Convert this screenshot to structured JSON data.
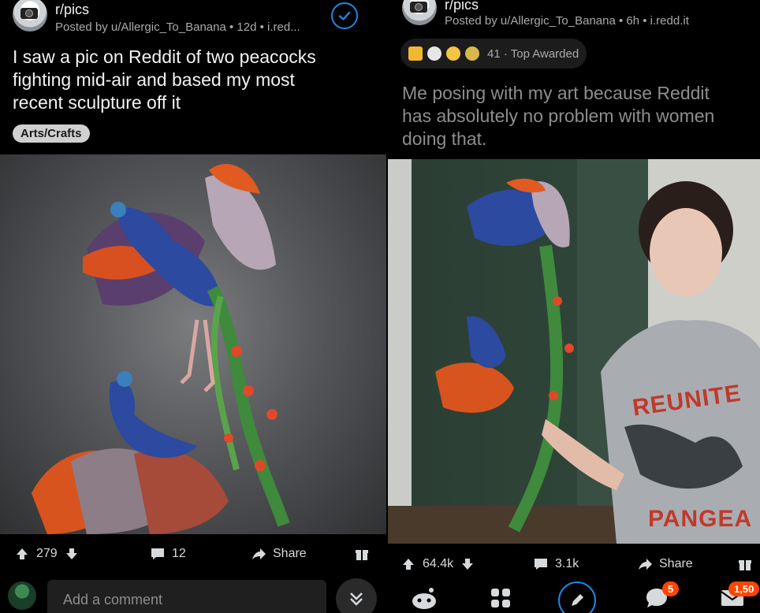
{
  "left": {
    "subreddit": "r/pics",
    "meta": "Posted by u/Allergic_To_Banana • 12d • i.red...",
    "title_lines": [
      "I saw a pic on Reddit of two peacocks",
      "fighting mid-air and based my most",
      "recent sculpture off it"
    ],
    "flair": "Arts/Crafts",
    "upvotes": "279",
    "comments": "12",
    "share": "Share",
    "comment_placeholder": "Add a comment"
  },
  "right": {
    "subreddit": "r/pics",
    "meta": "Posted by u/Allergic_To_Banana • 6h • i.redd.it",
    "awards_text": "41 · Top Awarded",
    "title_lines": [
      "Me posing with my art because Reddit",
      "has absolutely no problem with women",
      "doing that."
    ],
    "upvotes": "64.4k",
    "comments": "3.1k",
    "share": "Share",
    "chat_badge": "5",
    "inbox_badge": "1,50"
  },
  "colors": {
    "accent_blue": "#1e88e5",
    "brand_orange": "#ff4500",
    "awards_gold": "#f2b633"
  },
  "icons": [
    "avatar-camera-icon",
    "check-circle-icon",
    "upvote-arrow-icon",
    "downvote-arrow-icon",
    "comment-icon",
    "share-arrow-icon",
    "gift-icon",
    "chevron-double-down-icon",
    "reddit-home-icon",
    "grid-communities-icon",
    "pencil-create-icon",
    "chat-bubble-icon",
    "mail-icon"
  ]
}
